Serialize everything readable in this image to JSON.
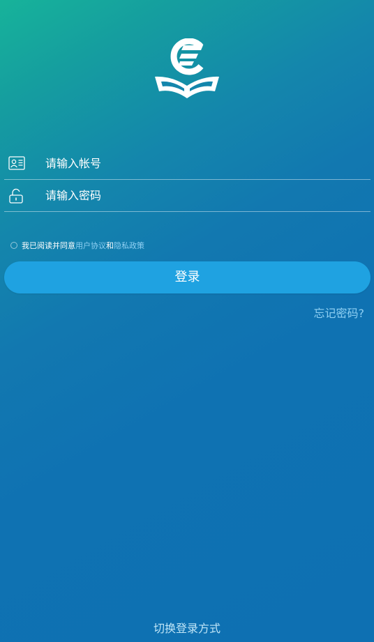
{
  "logo": {
    "icon": "book-logo-icon"
  },
  "account": {
    "placeholder": "请输入帐号",
    "icon": "id-card-icon"
  },
  "password": {
    "placeholder": "请输入密码",
    "icon": "unlock-icon"
  },
  "agreement": {
    "prefix": "我已阅读并同意",
    "user_agreement": "用户协议",
    "conjunction": "和",
    "privacy_policy": "隐私政策"
  },
  "login_button": "登录",
  "forgot_password": "忘记密码?",
  "switch_login": "切换登录方式",
  "colors": {
    "button": "#1fa2e1",
    "link": "#8fd0f3",
    "gradient_start": "#17b39a",
    "gradient_end": "#0e70b2"
  }
}
